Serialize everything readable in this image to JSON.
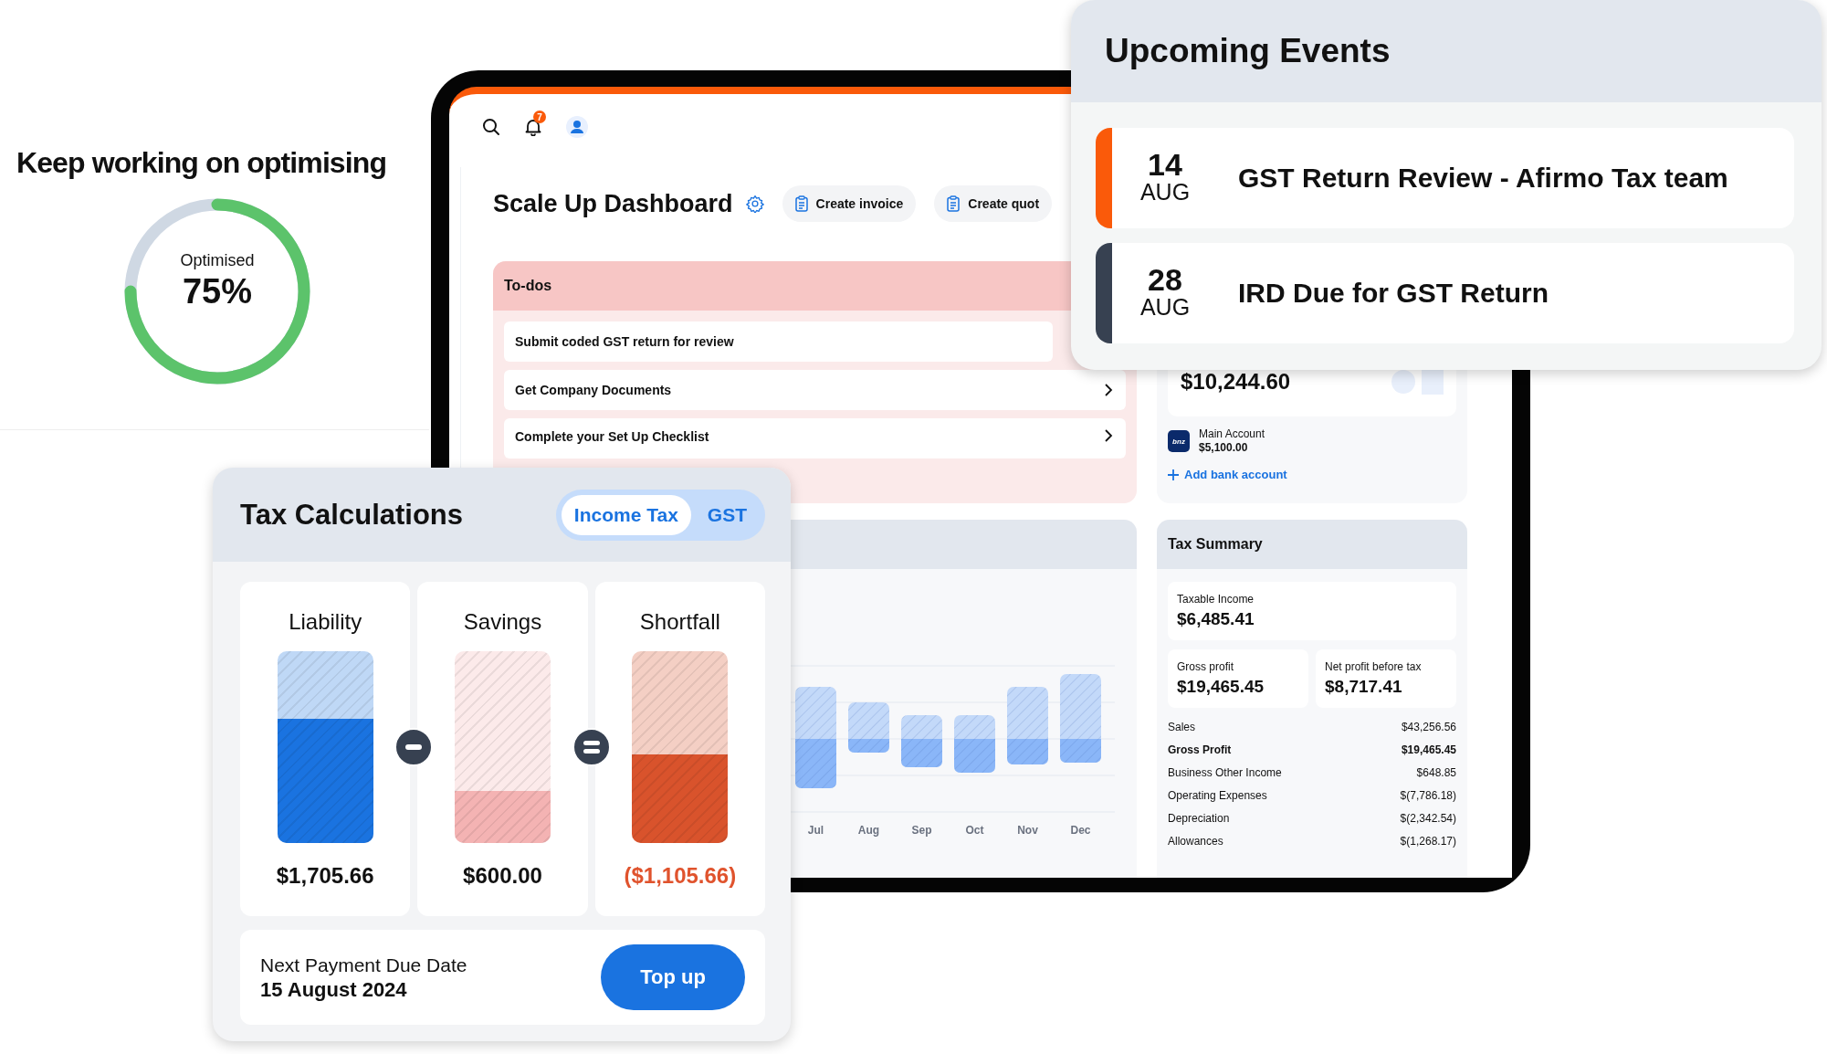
{
  "optimisation": {
    "title": "Keep working on optimising",
    "label": "Optimised",
    "value": "75%",
    "level": 0.75
  },
  "dashboard": {
    "notification_count": "7",
    "title": "Scale Up Dashboard",
    "actions": [
      {
        "label": "Create invoice"
      },
      {
        "label": "Create quot"
      }
    ],
    "todos": {
      "title": "To-dos",
      "items": [
        {
          "label": "Submit coded GST return for review",
          "chevron": false
        },
        {
          "label": "Get Company Documents",
          "chevron": true
        },
        {
          "label": "Complete your Set Up Checklist",
          "chevron": true
        }
      ]
    },
    "bank": {
      "balance": "$10,244.60",
      "logo_text": "bnz",
      "account_name": "Main Account",
      "account_balance": "$5,100.00",
      "add_label": "Add bank account"
    },
    "chart": {
      "month_labels": [
        "Jul",
        "Aug",
        "Sep",
        "Oct",
        "Nov",
        "Dec"
      ]
    },
    "tax_summary": {
      "title": "Tax Summary",
      "taxable": {
        "label": "Taxable Income",
        "value": "$6,485.41"
      },
      "tiles": [
        {
          "label": "Gross profit",
          "value": "$19,465.45"
        },
        {
          "label": "Net profit before tax",
          "value": "$8,717.41"
        }
      ],
      "rows": [
        {
          "label": "Sales",
          "value": "$43,256.56",
          "bold": false
        },
        {
          "label": "Gross Profit",
          "value": "$19,465.45",
          "bold": true
        },
        {
          "label": "Business Other Income",
          "value": "$648.85",
          "bold": false
        },
        {
          "label": "Operating Expenses",
          "value": "$(7,786.18)",
          "bold": false
        },
        {
          "label": "Depreciation",
          "value": "$(2,342.54)",
          "bold": false
        },
        {
          "label": "Allowances",
          "value": "$(1,268.17)",
          "bold": false
        }
      ]
    }
  },
  "tax_calculations": {
    "title": "Tax Calculations",
    "tabs": [
      {
        "label": "Income Tax",
        "selected": true
      },
      {
        "label": "GST",
        "selected": false
      }
    ],
    "columns": [
      {
        "label": "Liability",
        "amount": "$1,705.66",
        "level": 0.65,
        "color": "#1a73e0",
        "negative": false
      },
      {
        "label": "Savings",
        "amount": "$600.00",
        "level": 0.27,
        "color": "#f4b3b3",
        "negative": false
      },
      {
        "label": "Shortfall",
        "amount": "($1,105.66)",
        "level": 0.46,
        "color": "#d9532c",
        "negative": true
      }
    ],
    "next_payment": {
      "label": "Next Payment Due Date",
      "date": "15 August 2024",
      "button": "Top up"
    }
  },
  "upcoming_events": {
    "title": "Upcoming Events",
    "events": [
      {
        "day": "14",
        "month": "AUG",
        "title": "GST Return Review - Afirmo Tax team",
        "color": "#fa5a0a"
      },
      {
        "day": "28",
        "month": "AUG",
        "title": "IRD Due for GST Return",
        "color": "#374151"
      }
    ]
  }
}
